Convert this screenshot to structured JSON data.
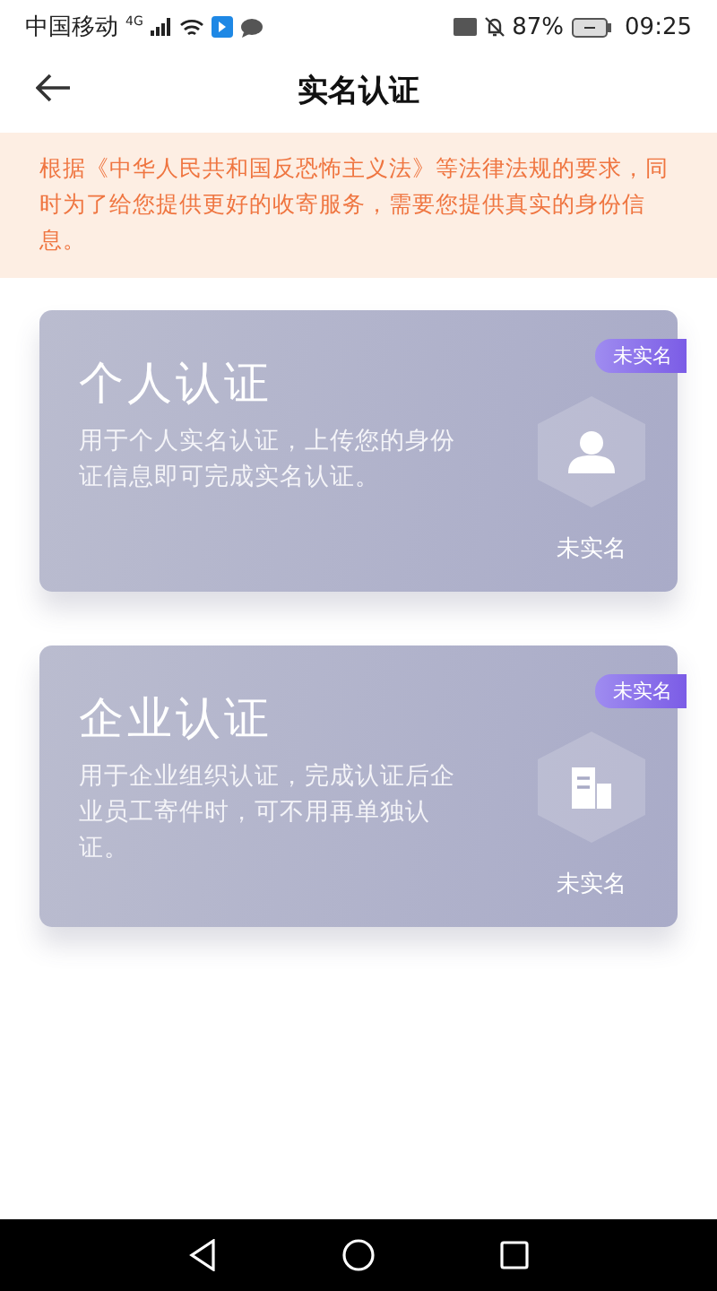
{
  "status_bar": {
    "carrier": "中国移动",
    "network": "4G",
    "battery": "87%",
    "time": "09:25"
  },
  "header": {
    "title": "实名认证"
  },
  "notice": {
    "text": "根据《中华人民共和国反恐怖主义法》等法律法规的要求，同时为了给您提供更好的收寄服务，需要您提供真实的身份信息。"
  },
  "cards": [
    {
      "kind": "person",
      "title": "个人认证",
      "description": "用于个人实名认证，上传您的身份证信息即可完成实名认证。",
      "badge": "未实名",
      "status": "未实名"
    },
    {
      "kind": "company",
      "title": "企业认证",
      "description": "用于企业组织认证，完成认证后企业员工寄件时，可不用再单独认证。",
      "badge": "未实名",
      "status": "未实名"
    }
  ]
}
